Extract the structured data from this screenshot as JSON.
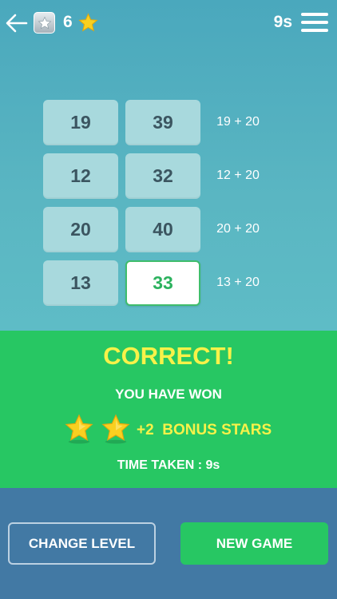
{
  "header": {
    "back_icon": "arrow-left-icon",
    "level_badge_icon": "silver-star-badge-icon",
    "stars_count": "6",
    "star_icon": "gold-star-icon",
    "timer": "9s",
    "menu_icon": "hamburger-menu-icon"
  },
  "grid": {
    "rows": [
      {
        "left": "19",
        "right": "39",
        "formula": "19 + 20"
      },
      {
        "left": "12",
        "right": "32",
        "formula": "12 + 20"
      },
      {
        "left": "20",
        "right": "40",
        "formula": "20 + 20"
      },
      {
        "left": "13",
        "right": "33",
        "formula": "13 + 20"
      }
    ]
  },
  "result": {
    "title": "CORRECT!",
    "subtitle": "YOU HAVE WON",
    "bonus_count": "+2",
    "bonus_label": "BONUS STARS",
    "time_taken": "TIME TAKEN : 9s"
  },
  "actions": {
    "change_level": "CHANGE LEVEL",
    "new_game": "NEW GAME"
  },
  "colors": {
    "top_bg": "#55b2c3",
    "tile_bg": "#a8d9dd",
    "answer_green": "#2cb25e",
    "result_bg": "#27c763",
    "highlight_yellow": "#f7f249",
    "bottom_bg": "#4279a4"
  }
}
